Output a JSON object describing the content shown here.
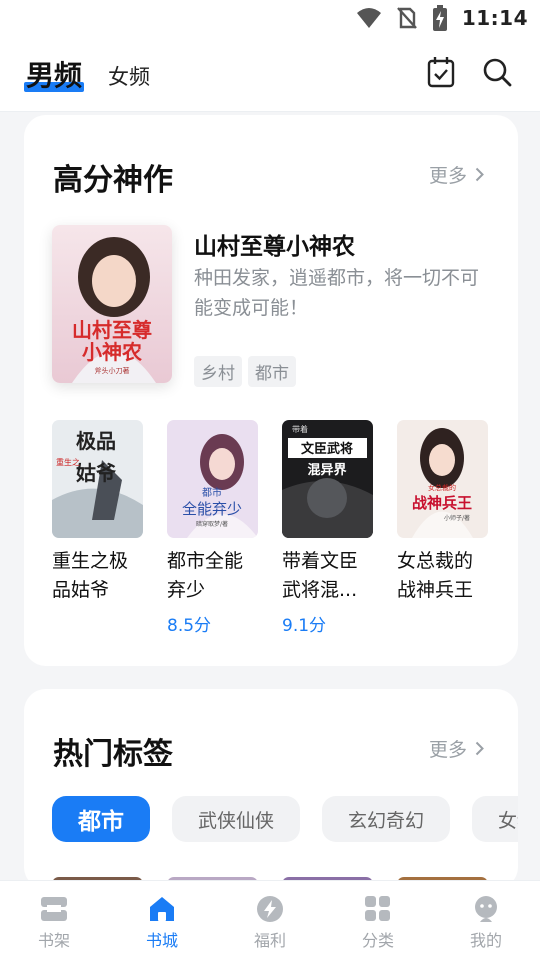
{
  "status": {
    "time": "11:14"
  },
  "header": {
    "tab_male": "男频",
    "tab_female": "女频"
  },
  "top_picks": {
    "title": "高分神作",
    "more": "更多",
    "featured": {
      "title": "山村至尊小神农",
      "description": "种田发家，逍遥都市，将一切不可能变成可能！",
      "tags": [
        "乡村",
        "都市"
      ],
      "cover_text": [
        "山村至尊",
        "小神农",
        "斧头小刀著"
      ]
    },
    "books": [
      {
        "title": "重生之极品姑爷",
        "score": "",
        "cover_text": [
          "极品",
          "姑爷",
          "重生之"
        ]
      },
      {
        "title": "都市全能弃少",
        "score": "8.5分",
        "cover_text": [
          "都市",
          "全能弃少",
          "暗穿取梦/著"
        ]
      },
      {
        "title": "带着文臣武将混...",
        "score": "9.1分",
        "cover_text": [
          "文臣武将",
          "混异界",
          "带着"
        ]
      },
      {
        "title": "女总裁的战神兵王",
        "score": "",
        "cover_text": [
          "女总裁的",
          "战神兵王",
          "小师子/著"
        ]
      }
    ]
  },
  "hot_tags": {
    "title": "热门标签",
    "more": "更多",
    "tags": [
      "都市",
      "武侠仙侠",
      "玄幻奇幻",
      "女频"
    ]
  },
  "bottom_nav": [
    {
      "label": "书架",
      "icon": "bookshelf-icon"
    },
    {
      "label": "书城",
      "icon": "home-icon"
    },
    {
      "label": "福利",
      "icon": "bolt-icon"
    },
    {
      "label": "分类",
      "icon": "grid-icon"
    },
    {
      "label": "我的",
      "icon": "profile-icon"
    }
  ],
  "colors": {
    "accent": "#1a7cf5",
    "muted": "#9aa0a6"
  }
}
